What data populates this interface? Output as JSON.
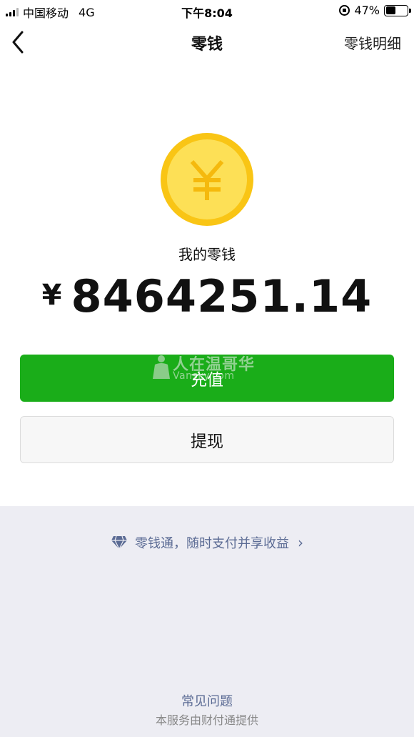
{
  "status_bar": {
    "carrier": "中国移动",
    "network": "4G",
    "time": "下午8:04",
    "battery_percent": "47%",
    "battery_level": 0.47
  },
  "nav": {
    "title": "零钱",
    "right_link": "零钱明细"
  },
  "wallet": {
    "coin_icon": "yuan-coin-icon",
    "label": "我的零钱",
    "currency_symbol": "¥",
    "amount": "8464251.14"
  },
  "actions": {
    "topup_label": "充值",
    "withdraw_label": "提现"
  },
  "watermark": {
    "title": "人在温哥华",
    "subtitle": "Vansky.com"
  },
  "footer": {
    "promo_text": "零钱通，随时支付并享收益",
    "promo_icon": "diamond-icon",
    "faq_label": "常见问题",
    "provider_text": "本服务由财付通提供"
  },
  "colors": {
    "primary_green": "#1aad19",
    "coin_outer": "#f9c515",
    "coin_inner": "#fde056",
    "link_blue": "#5b6b94",
    "bottom_bg": "#ededf3"
  }
}
